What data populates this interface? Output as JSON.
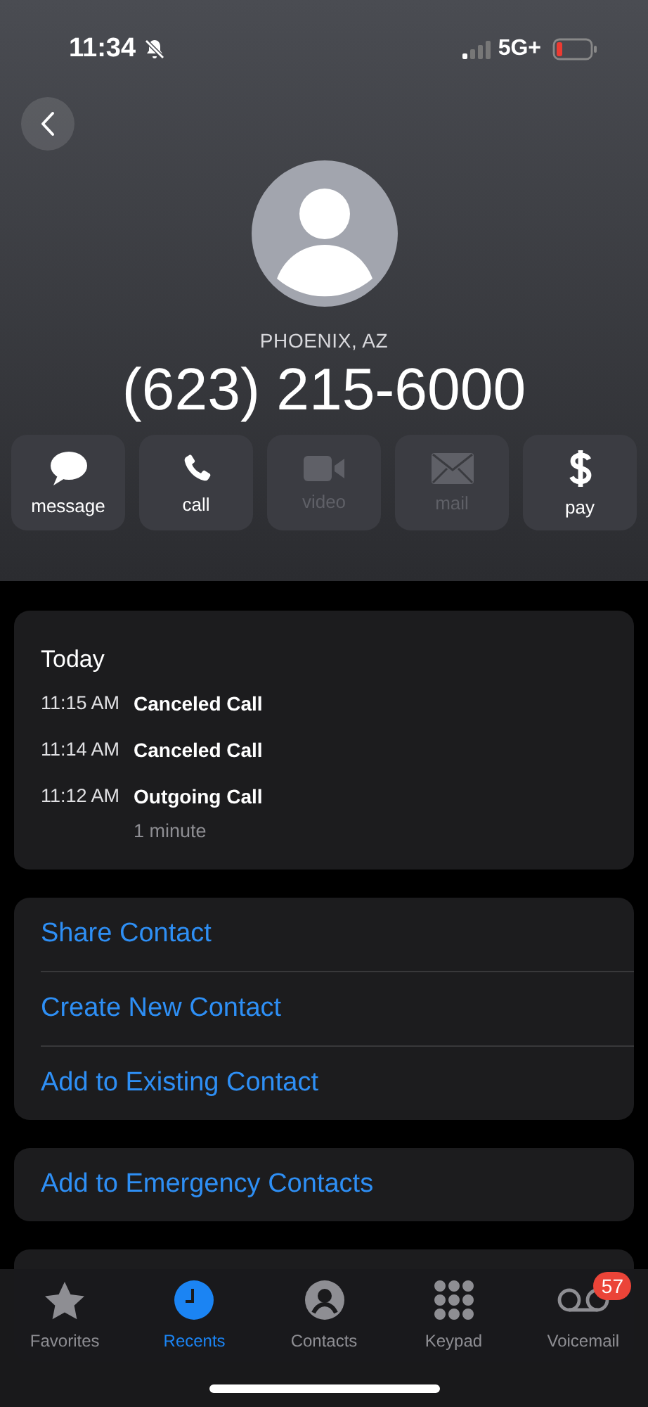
{
  "status_bar": {
    "time": "11:34",
    "silent": true,
    "network": "5G+"
  },
  "header": {
    "location": "PHOENIX, AZ",
    "phone_number": "(623) 215-6000"
  },
  "actions": [
    {
      "kind": "message",
      "label": "message",
      "disabled": false
    },
    {
      "kind": "call",
      "label": "call",
      "disabled": false
    },
    {
      "kind": "video",
      "label": "video",
      "disabled": true
    },
    {
      "kind": "mail",
      "label": "mail",
      "disabled": true
    },
    {
      "kind": "pay",
      "label": "pay",
      "disabled": false
    }
  ],
  "call_history": {
    "heading": "Today",
    "calls": [
      {
        "time": "11:15 AM",
        "type": "Canceled Call"
      },
      {
        "time": "11:14 AM",
        "type": "Canceled Call"
      },
      {
        "time": "11:12 AM",
        "type": "Outgoing Call",
        "duration": "1 minute"
      }
    ]
  },
  "contact_actions": [
    "Share Contact",
    "Create New Contact",
    "Add to Existing Contact"
  ],
  "emergency_action": "Add to Emergency Contacts",
  "tab_bar": [
    {
      "kind": "favorites",
      "label": "Favorites",
      "selected": false
    },
    {
      "kind": "recents",
      "label": "Recents",
      "selected": true
    },
    {
      "kind": "contacts",
      "label": "Contacts",
      "selected": false
    },
    {
      "kind": "keypad",
      "label": "Keypad",
      "selected": false
    },
    {
      "kind": "voicemail",
      "label": "Voicemail",
      "selected": false,
      "badge": "57"
    }
  ]
}
